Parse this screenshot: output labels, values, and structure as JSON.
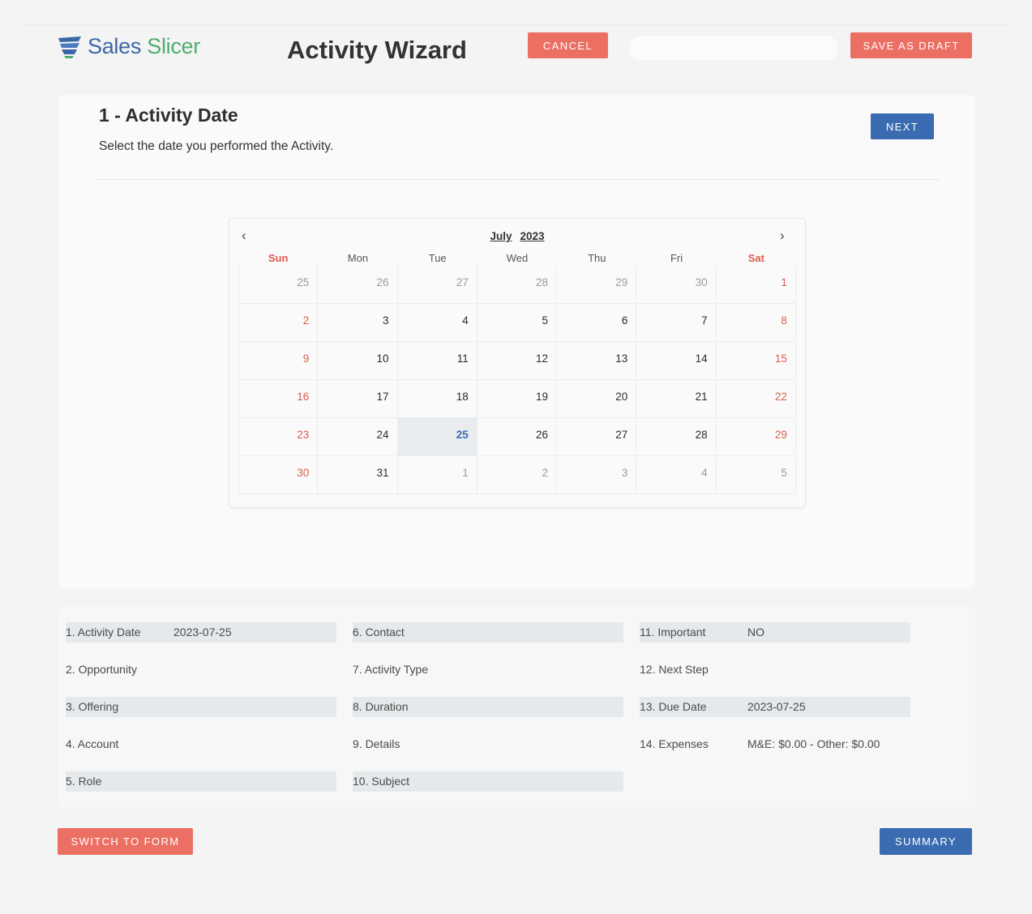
{
  "header": {
    "logo_part1": "Sales",
    "logo_part2": "Slicer",
    "title": "Activity Wizard",
    "cancel_label": "CANCEL",
    "search_value": "",
    "draft_label": "SAVE AS DRAFT"
  },
  "step": {
    "title": "1 - Activity Date",
    "description": "Select the date you performed the Activity.",
    "next_label": "NEXT"
  },
  "calendar": {
    "month": "July",
    "year": "2023",
    "prev_icon": "‹",
    "next_icon": "›",
    "weekdays": [
      "Sun",
      "Mon",
      "Tue",
      "Wed",
      "Thu",
      "Fri",
      "Sat"
    ],
    "selected_day": "25",
    "days": [
      [
        "25",
        "26",
        "27",
        "28",
        "29",
        "30",
        "1"
      ],
      [
        "2",
        "3",
        "4",
        "5",
        "6",
        "7",
        "8"
      ],
      [
        "9",
        "10",
        "11",
        "12",
        "13",
        "14",
        "15"
      ],
      [
        "16",
        "17",
        "18",
        "19",
        "20",
        "21",
        "22"
      ],
      [
        "23",
        "24",
        "25",
        "26",
        "27",
        "28",
        "29"
      ],
      [
        "30",
        "31",
        "1",
        "2",
        "3",
        "4",
        "5"
      ]
    ]
  },
  "summary": {
    "col1": [
      {
        "label": "1. Activity Date",
        "value": "2023-07-25"
      },
      {
        "label": "2. Opportunity",
        "value": ""
      },
      {
        "label": "3. Offering",
        "value": ""
      },
      {
        "label": "4. Account",
        "value": ""
      },
      {
        "label": "5. Role",
        "value": ""
      }
    ],
    "col2": [
      {
        "label": "6. Contact",
        "value": ""
      },
      {
        "label": "7. Activity Type",
        "value": ""
      },
      {
        "label": "8. Duration",
        "value": ""
      },
      {
        "label": "9. Details",
        "value": ""
      },
      {
        "label": "10. Subject",
        "value": ""
      }
    ],
    "col3": [
      {
        "label": "11. Important",
        "value": "NO"
      },
      {
        "label": "12. Next Step",
        "value": ""
      },
      {
        "label": "13. Due Date",
        "value": "2023-07-25"
      },
      {
        "label": "14. Expenses",
        "value": "M&E: $0.00 - Other: $0.00"
      }
    ]
  },
  "footer": {
    "switch_label": "SWITCH TO FORM",
    "summary_label": "SUMMARY"
  },
  "colors": {
    "accent_red": "#ec6f64",
    "accent_blue": "#3b6bb0",
    "weekend_red": "#dd5b4a",
    "logo_blue": "#3a67a6",
    "logo_green": "#4fae6e"
  }
}
